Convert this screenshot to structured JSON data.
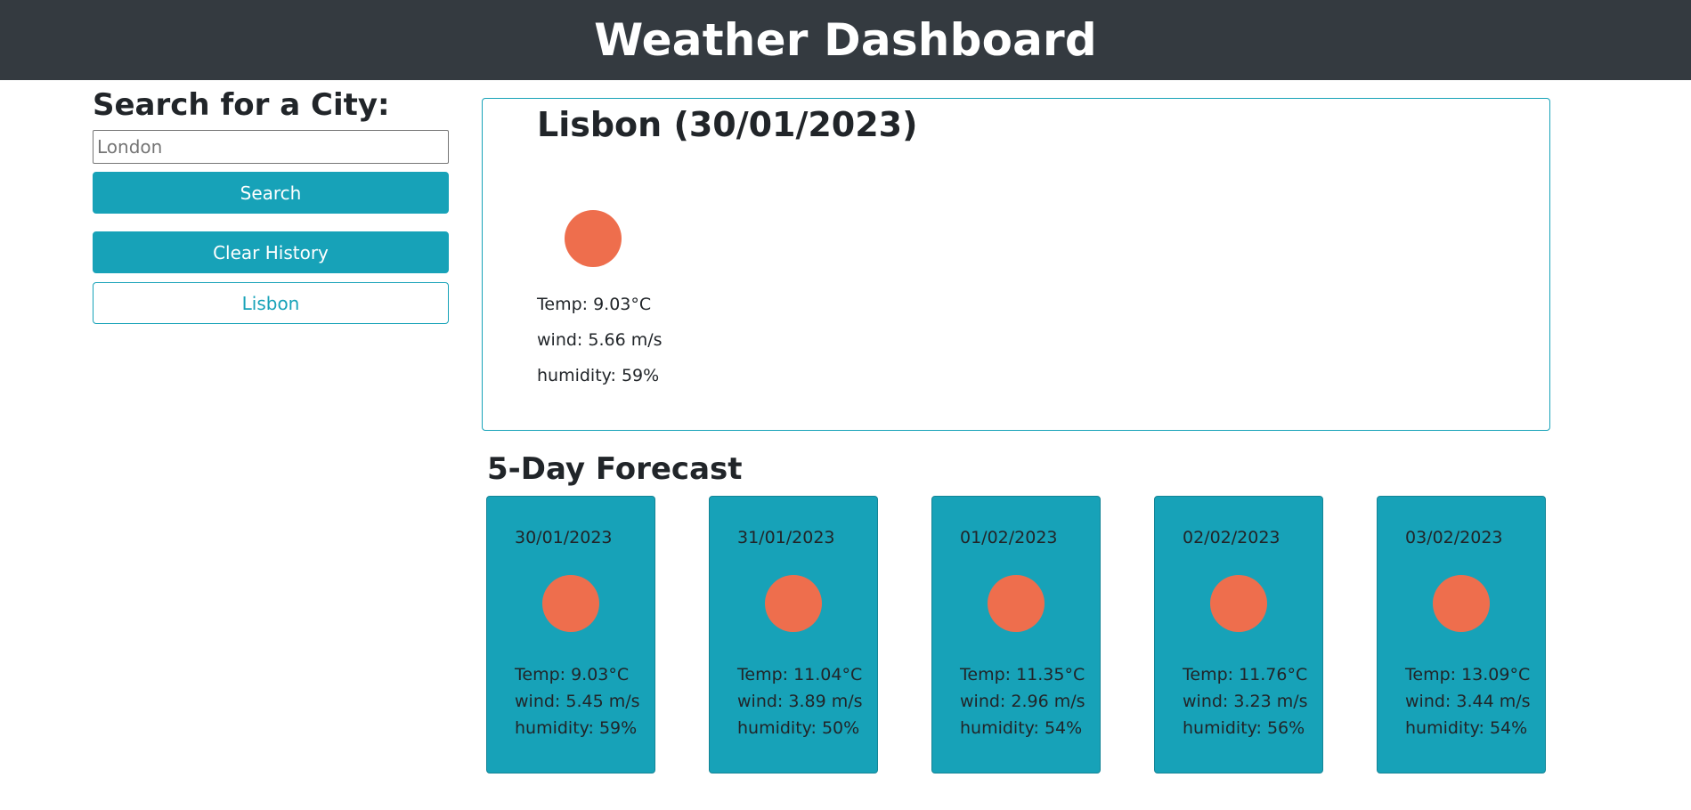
{
  "header": {
    "title": "Weather Dashboard"
  },
  "search": {
    "heading": "Search for a City:",
    "placeholder": "London",
    "value": "",
    "search_label": "Search",
    "clear_label": "Clear History",
    "history": [
      "Lisbon"
    ]
  },
  "current": {
    "title": "Lisbon (30/01/2023)",
    "icon": "sun-icon",
    "temp": "Temp: 9.03°C",
    "wind": "wind: 5.66 m/s",
    "humidity": "humidity: 59%"
  },
  "forecast": {
    "title": "5-Day Forecast",
    "days": [
      {
        "date": "30/01/2023",
        "icon": "sun-icon",
        "temp": "Temp: 9.03°C",
        "wind": "wind: 5.45 m/s",
        "humidity": "humidity: 59%"
      },
      {
        "date": "31/01/2023",
        "icon": "sun-icon",
        "temp": "Temp: 11.04°C",
        "wind": "wind: 3.89 m/s",
        "humidity": "humidity: 50%"
      },
      {
        "date": "01/02/2023",
        "icon": "sun-icon",
        "temp": "Temp: 11.35°C",
        "wind": "wind: 2.96 m/s",
        "humidity": "humidity: 54%"
      },
      {
        "date": "02/02/2023",
        "icon": "sun-icon",
        "temp": "Temp: 11.76°C",
        "wind": "wind: 3.23 m/s",
        "humidity": "humidity: 56%"
      },
      {
        "date": "03/02/2023",
        "icon": "sun-icon",
        "temp": "Temp: 13.09°C",
        "wind": "wind: 3.44 m/s",
        "humidity": "humidity: 54%"
      }
    ]
  },
  "colors": {
    "header_bg": "#343a40",
    "accent": "#17a2b8",
    "sun": "#ee6e4d"
  }
}
